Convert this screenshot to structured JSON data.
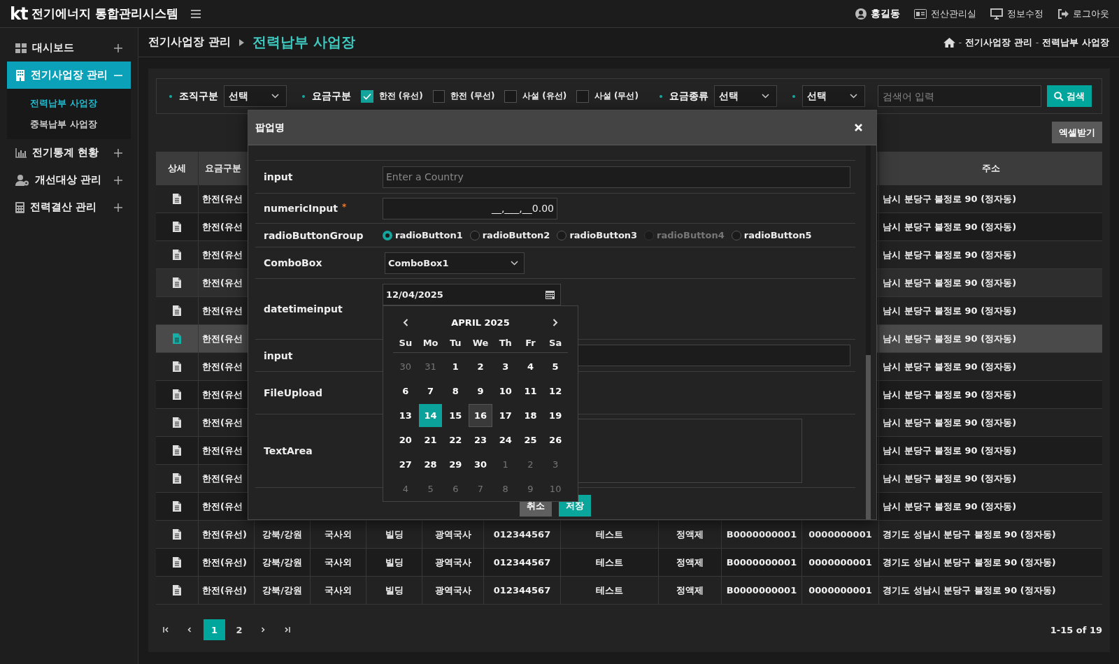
{
  "header": {
    "logo": "kt",
    "title": "전기에너지 통합관리시스템",
    "links": [
      {
        "kind": "user",
        "label": "홍길동"
      },
      {
        "kind": "office",
        "label": "전산관리실"
      },
      {
        "kind": "edit",
        "label": "정보수정"
      },
      {
        "kind": "logout",
        "label": "로그아웃"
      }
    ]
  },
  "sidebar": {
    "items": [
      {
        "kind": "dashboard",
        "label": "대시보드",
        "expanded": false,
        "selected": false
      },
      {
        "kind": "building",
        "label": "전기사업장 관리",
        "expanded": true,
        "selected": true,
        "children": [
          {
            "label": "전력납부 사업장",
            "selected": true
          },
          {
            "label": "중복납부 사업장",
            "selected": false
          }
        ]
      },
      {
        "kind": "chart",
        "label": "전기통계 현황",
        "expanded": false,
        "selected": false
      },
      {
        "kind": "usergear",
        "label": "개선대상 관리",
        "expanded": false,
        "selected": false
      },
      {
        "kind": "calculator",
        "label": "전력결산 관리",
        "expanded": false,
        "selected": false
      }
    ]
  },
  "page_title": {
    "parent": "전기사업장 관리",
    "current": "전력납부 사업장"
  },
  "breadcrumb": [
    {
      "kind": "sep",
      "text": "-"
    },
    {
      "kind": "link",
      "text": "전기사업장 관리"
    },
    {
      "kind": "sep",
      "text": "-"
    },
    {
      "kind": "link",
      "text": "전력납부 사업장"
    }
  ],
  "filters": [
    {
      "kind": "select",
      "label": "조직구분",
      "value": "선택"
    },
    {
      "kind": "checks",
      "label": "요금구분",
      "options": [
        {
          "label": "한전 (유선)",
          "checked": true
        },
        {
          "label": "한전 (무선)",
          "checked": false
        },
        {
          "label": "사설 (유선)",
          "checked": false
        },
        {
          "label": "사설 (무선)",
          "checked": false
        }
      ]
    },
    {
      "kind": "select",
      "label": "요금종류",
      "value": "선택"
    },
    {
      "kind": "select",
      "value": "선택"
    }
  ],
  "search": {
    "placeholder": "검색어 입력",
    "button": "검색"
  },
  "excel_button": "엑셀받기",
  "table": {
    "columns": [
      "상세",
      "요금구분",
      "",
      "",
      "",
      "",
      "",
      "",
      "",
      "",
      "",
      "주소"
    ],
    "rows": [
      {
        "cells": [
          "",
          "한전(유선",
          "",
          "",
          "",
          "",
          "",
          "",
          "",
          "",
          "",
          "남시 분당구 불정로 90 (정자동)"
        ],
        "selected": false,
        "hovered": false
      },
      {
        "cells": [
          "",
          "한전(유선",
          "",
          "",
          "",
          "",
          "",
          "",
          "",
          "",
          "",
          "남시 분당구 불정로 90 (정자동)"
        ],
        "selected": false,
        "hovered": false
      },
      {
        "cells": [
          "",
          "한전(유선",
          "",
          "",
          "",
          "",
          "",
          "",
          "",
          "",
          "",
          "남시 분당구 불정로 90 (정자동)"
        ],
        "selected": false,
        "hovered": false
      },
      {
        "cells": [
          "",
          "한전(유선",
          "",
          "",
          "",
          "",
          "",
          "",
          "",
          "",
          "",
          "남시 분당구 불정로 90 (정자동)"
        ],
        "selected": false,
        "hovered": true
      },
      {
        "cells": [
          "",
          "한전(유선",
          "",
          "",
          "",
          "",
          "",
          "",
          "",
          "",
          "",
          "남시 분당구 불정로 90 (정자동)"
        ],
        "selected": false,
        "hovered": false
      },
      {
        "cells": [
          "",
          "한전(유선",
          "",
          "",
          "",
          "",
          "",
          "",
          "",
          "",
          "",
          "남시 분당구 불정로 90 (정자동)"
        ],
        "selected": true,
        "hovered": false
      },
      {
        "cells": [
          "",
          "한전(유선",
          "",
          "",
          "",
          "",
          "",
          "",
          "",
          "",
          "",
          "남시 분당구 불정로 90 (정자동)"
        ],
        "selected": false,
        "hovered": false
      },
      {
        "cells": [
          "",
          "한전(유선",
          "",
          "",
          "",
          "",
          "",
          "",
          "",
          "",
          "",
          "남시 분당구 불정로 90 (정자동)"
        ],
        "selected": false,
        "hovered": false
      },
      {
        "cells": [
          "",
          "한전(유선",
          "",
          "",
          "",
          "",
          "",
          "",
          "",
          "",
          "",
          "남시 분당구 불정로 90 (정자동)"
        ],
        "selected": false,
        "hovered": false
      },
      {
        "cells": [
          "",
          "한전(유선",
          "",
          "",
          "",
          "",
          "",
          "",
          "",
          "",
          "",
          "남시 분당구 불정로 90 (정자동)"
        ],
        "selected": false,
        "hovered": false
      },
      {
        "cells": [
          "",
          "한전(유선",
          "",
          "",
          "",
          "",
          "",
          "",
          "",
          "",
          "",
          "남시 분당구 불정로 90 (정자동)"
        ],
        "selected": false,
        "hovered": false
      },
      {
        "cells": [
          "",
          "한전(유선",
          "",
          "",
          "",
          "",
          "",
          "",
          "",
          "",
          "",
          "남시 분당구 불정로 90 (정자동)"
        ],
        "selected": false,
        "hovered": false
      },
      {
        "cells": [
          "",
          "한전(유선)",
          "강북/강원",
          "국사외",
          "빌딩",
          "광역국사",
          "012344567",
          "테스트",
          "정액제",
          "B0000000001",
          "0000000001",
          "경기도 성남시 분당구 불정로 90 (정자동)"
        ],
        "selected": false,
        "hovered": false
      },
      {
        "cells": [
          "",
          "한전(유선)",
          "강북/강원",
          "국사외",
          "빌딩",
          "광역국사",
          "012344567",
          "테스트",
          "정액제",
          "B0000000001",
          "0000000001",
          "경기도 성남시 분당구 불정로 90 (정자동)"
        ],
        "selected": false,
        "hovered": false
      },
      {
        "cells": [
          "",
          "한전(유선)",
          "강북/강원",
          "국사외",
          "빌딩",
          "광역국사",
          "012344567",
          "테스트",
          "정액제",
          "B0000000001",
          "0000000001",
          "경기도 성남시 분당구 불정로 90 (정자동)"
        ],
        "selected": false,
        "hovered": false
      }
    ]
  },
  "pagination": {
    "pages": [
      {
        "label": "1",
        "selected": true
      },
      {
        "label": "2",
        "selected": false
      }
    ],
    "range": "1-15 of 19"
  },
  "popup": {
    "title": "팝업명",
    "rows": [
      {
        "kind": "text",
        "label": "input",
        "placeholder": "Enter a Country"
      },
      {
        "kind": "numeric",
        "label": "numericInput",
        "required_mark": "*",
        "value": "__,___,__0.00"
      },
      {
        "kind": "radio",
        "label": "radioButtonGroup",
        "options": [
          {
            "label": "radioButton1",
            "selected": true,
            "disabled": false
          },
          {
            "label": "radioButton2",
            "selected": false,
            "disabled": false
          },
          {
            "label": "radioButton3",
            "selected": false,
            "disabled": false
          },
          {
            "label": "radioButton4",
            "selected": false,
            "disabled": true
          },
          {
            "label": "radioButton5",
            "selected": false,
            "disabled": false
          }
        ]
      },
      {
        "kind": "combo",
        "label": "ComboBox",
        "value": "ComboBox1"
      },
      {
        "kind": "date",
        "label": "datetimeinput",
        "value": "12/04/2025"
      },
      {
        "kind": "text",
        "label": "input"
      },
      {
        "kind": "file",
        "label": "FileUpload"
      },
      {
        "kind": "textarea",
        "label": "TextArea"
      }
    ],
    "buttons": [
      {
        "kind": "cancel",
        "label": "취소"
      },
      {
        "kind": "primary",
        "label": "저장"
      }
    ],
    "calendar": {
      "title": "APRIL 2025",
      "weekdays": [
        "Su",
        "Mo",
        "Tu",
        "We",
        "Th",
        "Fr",
        "Sa"
      ],
      "weeks": [
        [
          {
            "label": "30",
            "muted": true,
            "selected": false,
            "today": false
          },
          {
            "label": "31",
            "muted": true,
            "selected": false,
            "today": false
          },
          {
            "label": "1",
            "muted": false,
            "selected": false,
            "today": false
          },
          {
            "label": "2",
            "muted": false,
            "selected": false,
            "today": false
          },
          {
            "label": "3",
            "muted": false,
            "selected": false,
            "today": false
          },
          {
            "label": "4",
            "muted": false,
            "selected": false,
            "today": false
          },
          {
            "label": "5",
            "muted": false,
            "selected": false,
            "today": false
          }
        ],
        [
          {
            "label": "6",
            "muted": false,
            "selected": false,
            "today": false
          },
          {
            "label": "7",
            "muted": false,
            "selected": false,
            "today": false
          },
          {
            "label": "8",
            "muted": false,
            "selected": false,
            "today": false
          },
          {
            "label": "9",
            "muted": false,
            "selected": false,
            "today": false
          },
          {
            "label": "10",
            "muted": false,
            "selected": false,
            "today": false
          },
          {
            "label": "11",
            "muted": false,
            "selected": false,
            "today": false
          },
          {
            "label": "12",
            "muted": false,
            "selected": false,
            "today": false
          }
        ],
        [
          {
            "label": "13",
            "muted": false,
            "selected": false,
            "today": false
          },
          {
            "label": "14",
            "muted": false,
            "selected": true,
            "today": false
          },
          {
            "label": "15",
            "muted": false,
            "selected": false,
            "today": false
          },
          {
            "label": "16",
            "muted": false,
            "selected": false,
            "today": true
          },
          {
            "label": "17",
            "muted": false,
            "selected": false,
            "today": false
          },
          {
            "label": "18",
            "muted": false,
            "selected": false,
            "today": false
          },
          {
            "label": "19",
            "muted": false,
            "selected": false,
            "today": false
          }
        ],
        [
          {
            "label": "20",
            "muted": false,
            "selected": false,
            "today": false
          },
          {
            "label": "21",
            "muted": false,
            "selected": false,
            "today": false
          },
          {
            "label": "22",
            "muted": false,
            "selected": false,
            "today": false
          },
          {
            "label": "23",
            "muted": false,
            "selected": false,
            "today": false
          },
          {
            "label": "24",
            "muted": false,
            "selected": false,
            "today": false
          },
          {
            "label": "25",
            "muted": false,
            "selected": false,
            "today": false
          },
          {
            "label": "26",
            "muted": false,
            "selected": false,
            "today": false
          }
        ],
        [
          {
            "label": "27",
            "muted": false,
            "selected": false,
            "today": false
          },
          {
            "label": "28",
            "muted": false,
            "selected": false,
            "today": false
          },
          {
            "label": "29",
            "muted": false,
            "selected": false,
            "today": false
          },
          {
            "label": "30",
            "muted": false,
            "selected": false,
            "today": false
          },
          {
            "label": "1",
            "muted": true,
            "selected": false,
            "today": false
          },
          {
            "label": "2",
            "muted": true,
            "selected": false,
            "today": false
          },
          {
            "label": "3",
            "muted": true,
            "selected": false,
            "today": false
          }
        ],
        [
          {
            "label": "4",
            "muted": true,
            "selected": false,
            "today": false
          },
          {
            "label": "5",
            "muted": true,
            "selected": false,
            "today": false
          },
          {
            "label": "6",
            "muted": true,
            "selected": false,
            "today": false
          },
          {
            "label": "7",
            "muted": true,
            "selected": false,
            "today": false
          },
          {
            "label": "8",
            "muted": true,
            "selected": false,
            "today": false
          },
          {
            "label": "9",
            "muted": true,
            "selected": false,
            "today": false
          },
          {
            "label": "10",
            "muted": true,
            "selected": false,
            "today": false
          }
        ]
      ]
    }
  }
}
